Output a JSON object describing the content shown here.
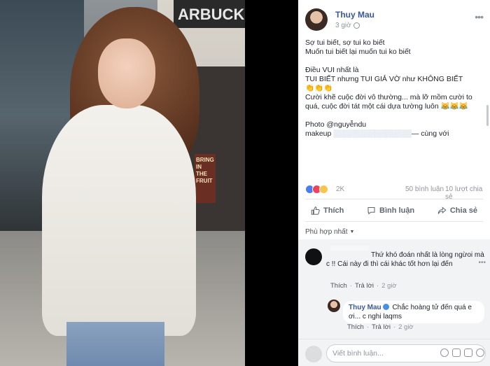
{
  "photo": {
    "sign_text": "ARBUCK",
    "poster_text": "BRING\nIN THE\nFRUIT"
  },
  "post": {
    "author": "Thuy Mau",
    "time": "3 giờ",
    "lines": [
      "Sợ tui biết, sợ tui ko biết",
      "Muốn tui biết lại muốn tui ko biết",
      "",
      "Điều VUI nhất là",
      "TUI BIẾT nhưng TUI GIẢ VỜ như KHÔNG BIẾT",
      "👏👏👏",
      "Cười khẽ cuộc đời vô thường... mà lỡ mồm cười to quá, cuộc đời tát một cái dựa tường luôn 😹😹😹",
      "",
      "Photo @nguyễndu",
      "makeup"
    ],
    "tag_suffix": "— cùng với"
  },
  "reactions": {
    "count": "2K",
    "comments": "50 bình luận",
    "shares": "10 lượt chia sẻ"
  },
  "actions": {
    "like": "Thích",
    "comment": "Bình luận",
    "share": "Chia sẻ"
  },
  "sort": {
    "label": "Phù hợp nhất"
  },
  "comments": [
    {
      "text": "Thứ khó đoán nhất là lòng ngừoi mà c !! Cái này đi thì cái khác tốt hơn lại đến",
      "like": "Thích",
      "reply": "Trả lời",
      "time": "2 giờ"
    },
    {
      "author": "Thuy Mau",
      "text": "Chắc hoàng tử đến quá e ơi... c nghi laqms",
      "like": "Thích",
      "reply": "Trả lời",
      "time": "2 giờ"
    }
  ],
  "write": {
    "placeholder": "Viết bình luận..."
  },
  "icons": [
    "globe-icon",
    "more-icon",
    "like-icon",
    "comment-icon",
    "share-icon",
    "camera-icon",
    "gif-icon",
    "sticker-icon",
    "emoji-icon"
  ],
  "colors": {
    "link": "#385898",
    "muted": "#90949c",
    "like_reaction": "#4a7ef0",
    "love_reaction": "#f0425c",
    "haha_reaction": "#f7c54b"
  }
}
